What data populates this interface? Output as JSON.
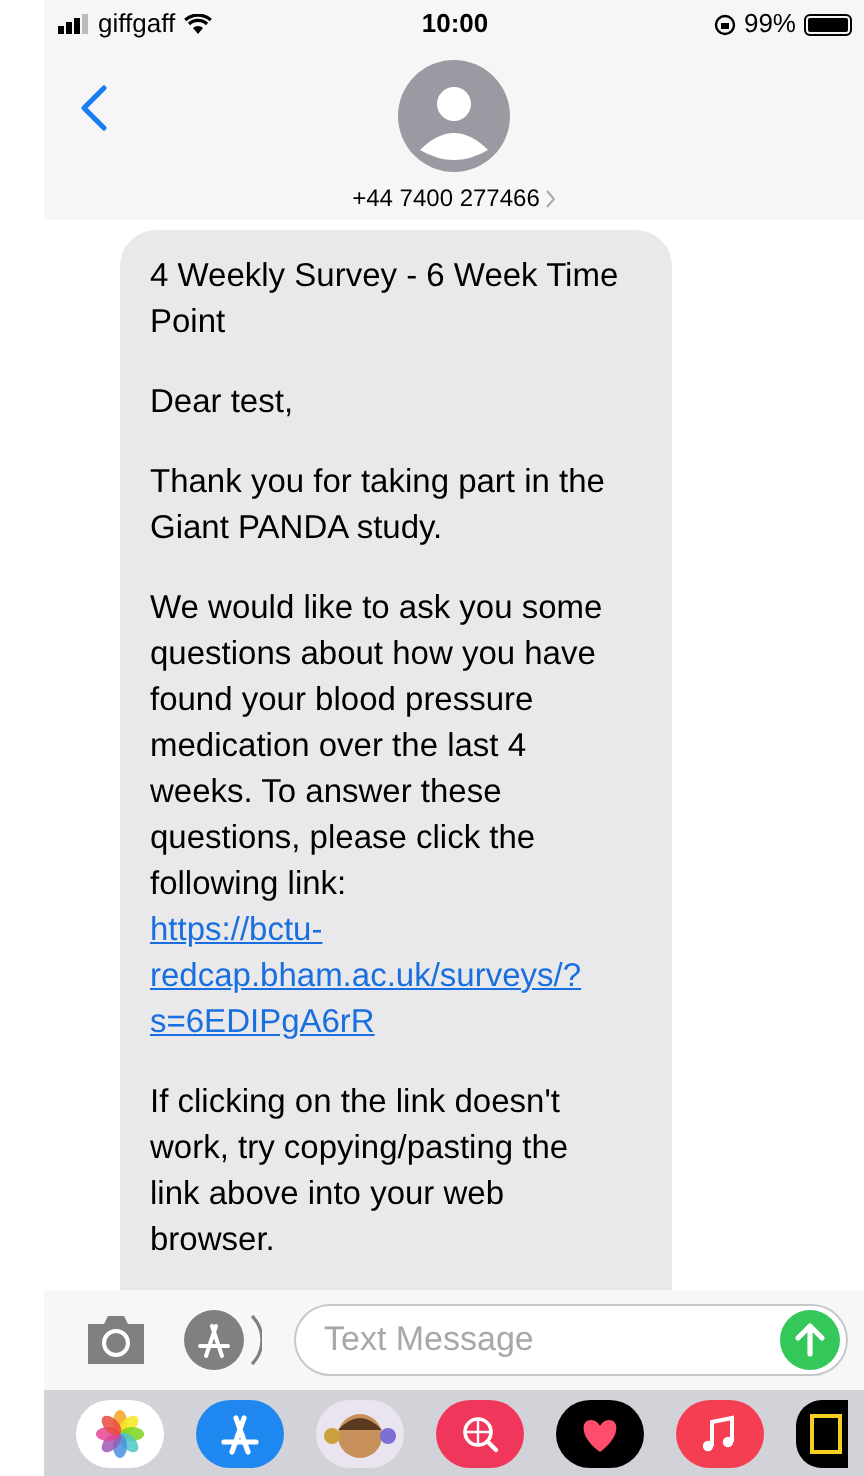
{
  "status_bar": {
    "carrier": "giffgaff",
    "time": "10:00",
    "battery": "99%",
    "level": 0.99
  },
  "header": {
    "contact": "+44 7400 277466"
  },
  "message": {
    "paragraphs": [
      {
        "text": "4 Weekly Survey - 6 Week Time Point"
      },
      {
        "text": "Dear test,"
      },
      {
        "text": "Thank you for taking part in the Giant PANDA study."
      },
      {
        "text": "We would like to ask you some questions about how you have found your blood pressure medication over the last 4 weeks. To answer these questions, please click the following link:",
        "link": "https://bctu-redcap.bham.ac.uk/surveys/?s=6EDIPgA6rR"
      },
      {
        "text": "If clicking on the link doesn't work, try copying/pasting the link above into your web browser."
      }
    ]
  },
  "composer": {
    "placeholder": "Text Message"
  },
  "dock": [
    {
      "kind": "photos"
    },
    {
      "kind": "appstore"
    },
    {
      "kind": "memoji"
    },
    {
      "kind": "search"
    },
    {
      "kind": "heart"
    },
    {
      "kind": "music"
    },
    {
      "kind": "partial"
    }
  ]
}
